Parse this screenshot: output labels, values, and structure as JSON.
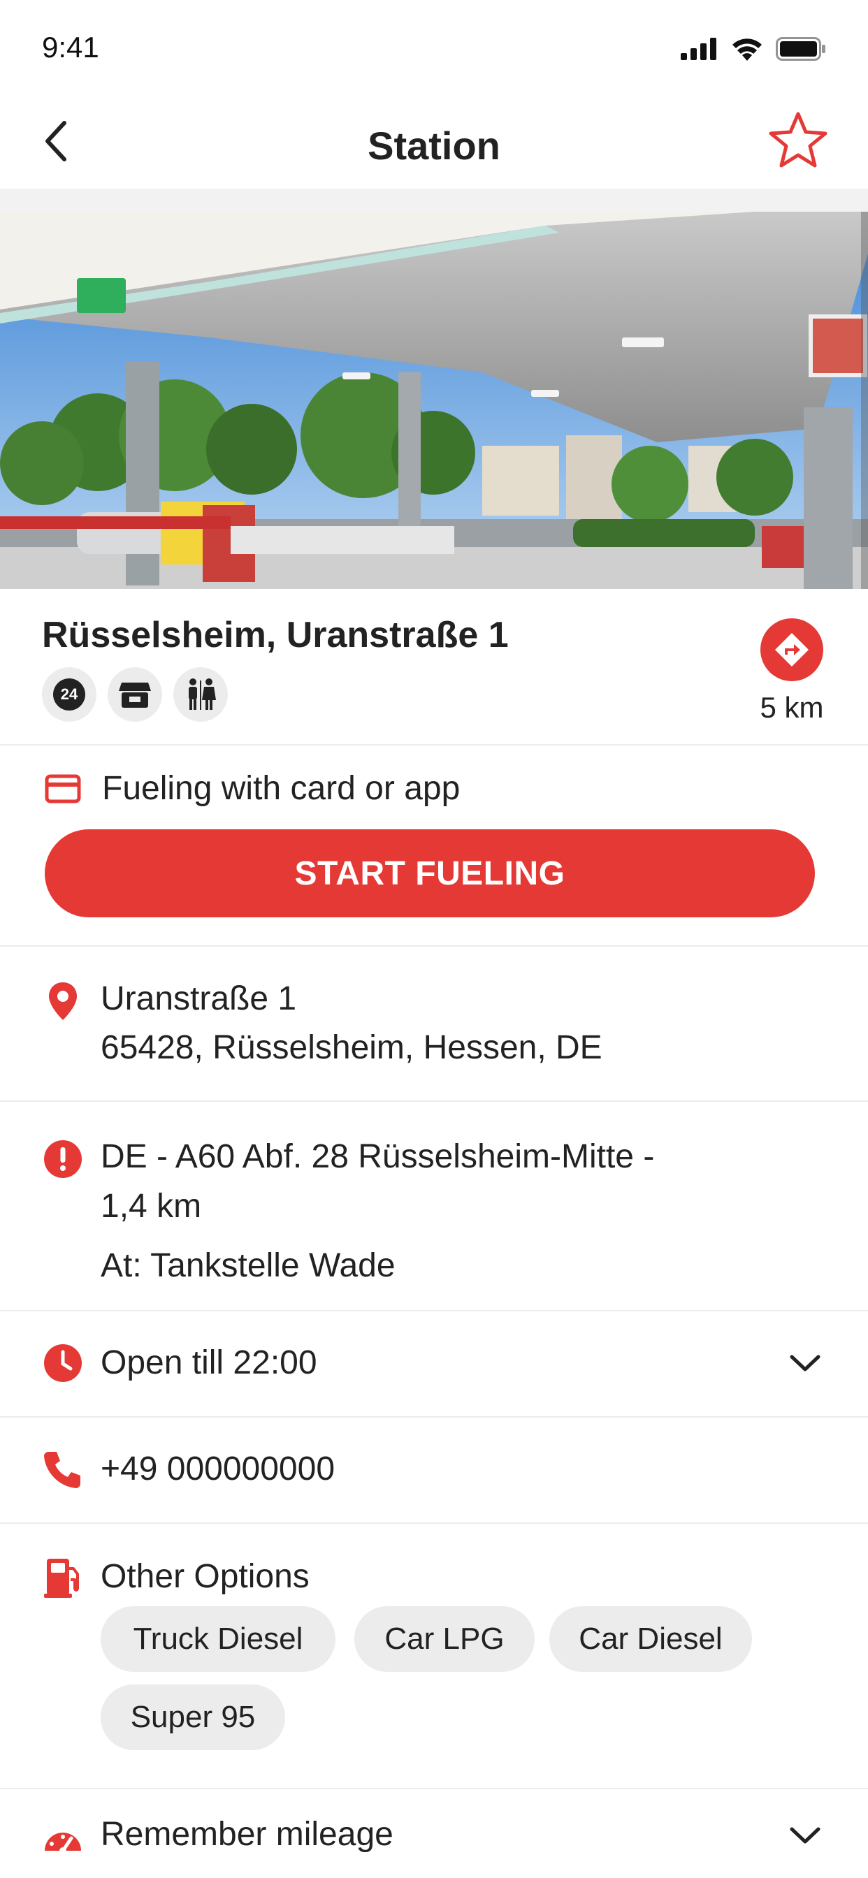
{
  "status_bar": {
    "time": "9:41"
  },
  "nav": {
    "title": "Station"
  },
  "station": {
    "name": "Rüsselsheim, Uranstraße 1",
    "amenities": [
      "24h-icon",
      "shop-icon",
      "restroom-icon"
    ],
    "amenity_24_label": "24",
    "distance": "5 km"
  },
  "fueling": {
    "label": "Fueling with card or app",
    "button_label": "START FUELING"
  },
  "address": {
    "line1": "Uranstraße 1",
    "line2": "65428, Rüsselsheim, Hessen, DE"
  },
  "location_note": {
    "line1": "DE - A60 Abf. 28 Rüsselsheim-Mitte -",
    "line2": "1,4 km",
    "at": "At: Tankstelle Wade"
  },
  "hours": {
    "label": "Open till 22:00"
  },
  "phone": {
    "number": "+49 000000000"
  },
  "other_options": {
    "title": "Other Options",
    "chips": [
      "Truck Diesel",
      "Car LPG",
      "Car Diesel",
      "Super 95"
    ]
  },
  "mileage": {
    "label": "Remember mileage"
  },
  "colors": {
    "accent": "#e53935",
    "chip_bg": "#ececec",
    "divider": "#ececec"
  }
}
